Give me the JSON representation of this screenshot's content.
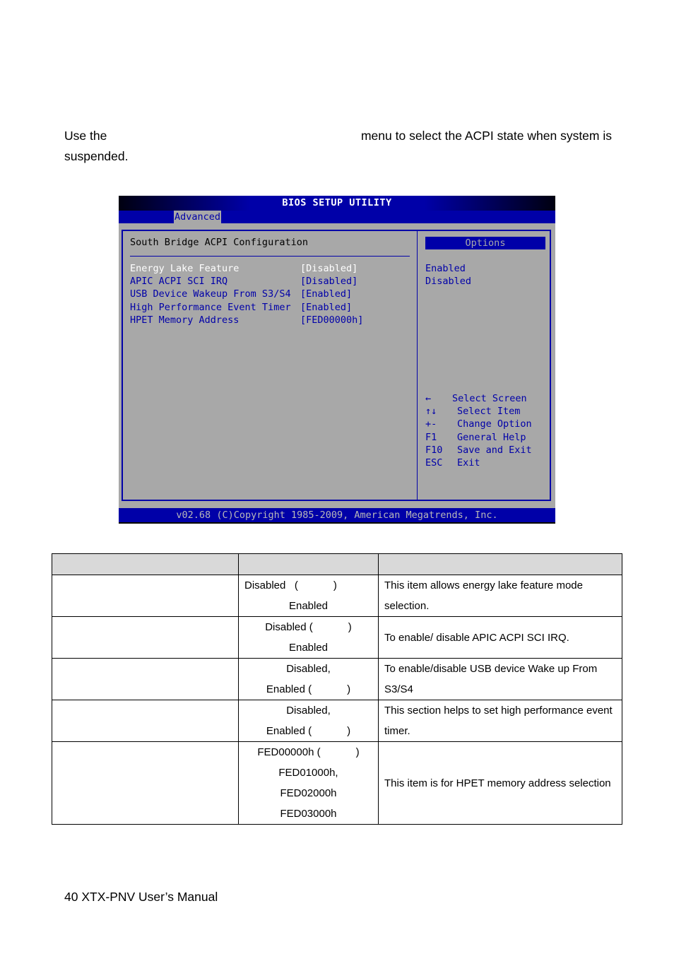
{
  "intro": {
    "prefix": "Use the",
    "suffix": "menu to select the ACPI state when system is",
    "line2": "suspended."
  },
  "bios": {
    "title": "BIOS SETUP UTILITY",
    "active_tab": "Advanced",
    "heading": "South Bridge ACPI Configuration",
    "items": [
      {
        "label": "Energy Lake Feature",
        "value": "[Disabled]",
        "selected": true
      },
      {
        "label": "APIC ACPI SCI IRQ",
        "value": "[Disabled]",
        "selected": false
      },
      {
        "label": "USB Device Wakeup From S3/S4",
        "value": "[Enabled]",
        "selected": false
      },
      {
        "label": "High Performance Event Timer",
        "value": "[Enabled]",
        "selected": false
      },
      {
        "label": "HPET Memory Address",
        "value": "[FED00000h]",
        "selected": false
      }
    ],
    "options_header": "Options",
    "options": [
      "Enabled",
      "Disabled"
    ],
    "key_help": [
      {
        "key": "←",
        "desc": "Select Screen"
      },
      {
        "key": "↑↓",
        "desc": "Select Item"
      },
      {
        "key": "+-",
        "desc": "Change Option"
      },
      {
        "key": "F1",
        "desc": "General Help"
      },
      {
        "key": "F10",
        "desc": "Save and Exit"
      },
      {
        "key": "ESC",
        "desc": "Exit"
      }
    ],
    "footer": "v02.68 (C)Copyright 1985-2009, American Megatrends, Inc.",
    "colors": {
      "background": "#a8a8a8",
      "accent": "#0000a8",
      "selected_text": "#ffffff"
    }
  },
  "table": {
    "headers": [
      "",
      "",
      ""
    ],
    "rows": [
      {
        "item": "",
        "options": [
          "Disabled   (            )",
          "Enabled"
        ],
        "description": "This item allows energy lake feature mode selection."
      },
      {
        "item": "",
        "options": [
          "Disabled (            )",
          "Enabled"
        ],
        "description": "To enable/ disable APIC ACPI SCI IRQ."
      },
      {
        "item": "",
        "options": [
          "Disabled,",
          "Enabled (            )"
        ],
        "description": "To enable/disable USB device Wake up From S3/S4"
      },
      {
        "item": "",
        "options": [
          "Disabled,",
          "Enabled (            )"
        ],
        "description": "This section helps to set high performance event timer."
      },
      {
        "item": "",
        "options": [
          "FED00000h (            )",
          "FED01000h,",
          "FED02000h",
          "FED03000h"
        ],
        "description": "This item is for HPET memory address selection"
      }
    ]
  },
  "footer": "40 XTX-PNV User’s Manual"
}
